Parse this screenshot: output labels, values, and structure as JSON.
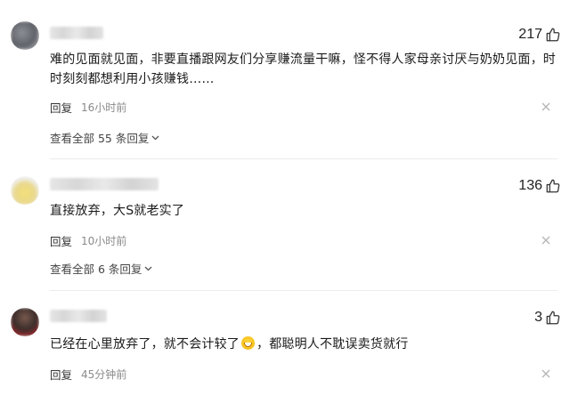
{
  "comments": [
    {
      "likes": "217",
      "text": "难的见面就见面，非要直播跟网友们分享赚流量干嘛，怪不得人家母亲讨厌与奶奶见面，时时刻刻都想利用小孩赚钱……",
      "reply_label": "回复",
      "time": "16小时前",
      "view_all": "查看全部 55 条回复"
    },
    {
      "likes": "136",
      "text": "直接放弃，大S就老实了",
      "reply_label": "回复",
      "time": "10小时前",
      "view_all": "查看全部 6 条回复"
    },
    {
      "likes": "3",
      "text_before": "已经在心里放弃了，就不会计较了",
      "emoji": "grin-emoji",
      "text_after": "，都聪明人不耽误卖货就行",
      "reply_label": "回复",
      "time": "45分钟前"
    }
  ],
  "colors": {
    "text": "#1a1a1a",
    "meta": "#8a8a8a",
    "separator": "#ececec"
  }
}
